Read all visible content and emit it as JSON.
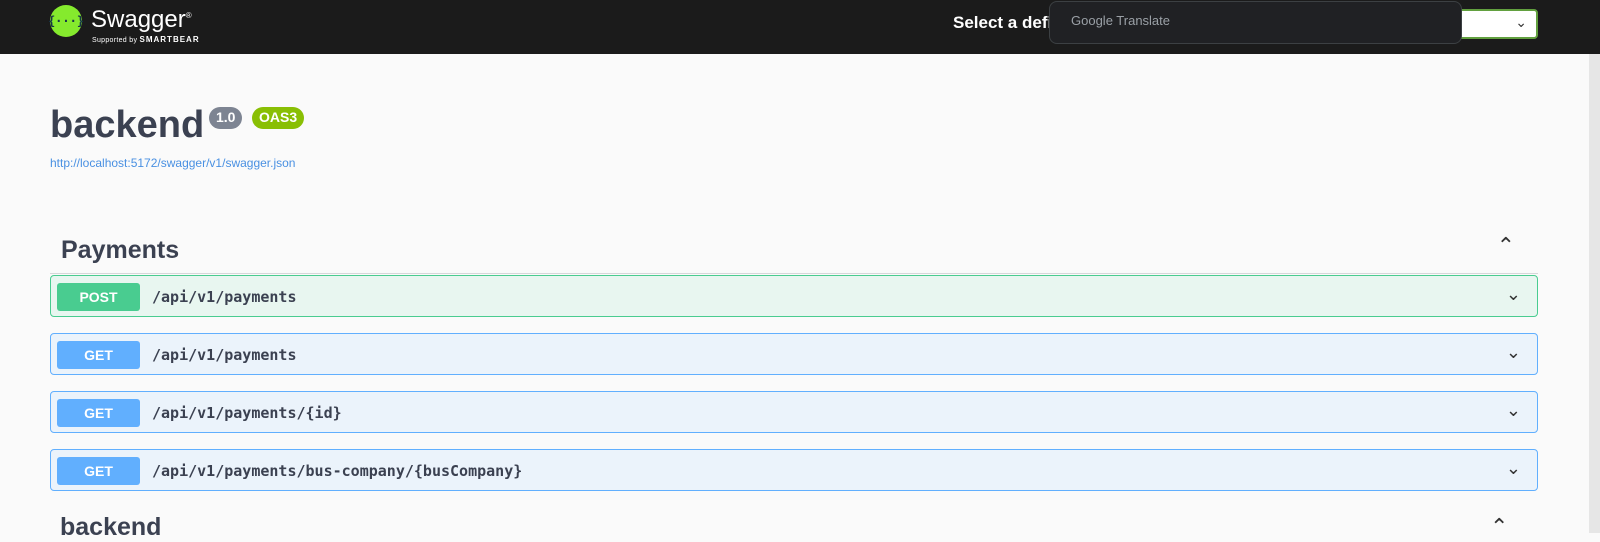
{
  "header": {
    "brand": "Swagger",
    "brand_tm": "®",
    "brand_sub_prefix": "Supported by",
    "brand_sub_company": "SMARTBEAR",
    "logo_glyph": "{···}",
    "select_label": "Select a definition",
    "select_chevron_icon": "chevron-down-icon"
  },
  "translate_popup": {
    "label": "Google Translate"
  },
  "info": {
    "title": "backend",
    "version": "1.0",
    "oas": "OAS3",
    "spec_url": "http://localhost:5172/swagger/v1/swagger.json"
  },
  "sections": [
    {
      "name": "Payments",
      "toggle": "⌃",
      "operations": [
        {
          "method": "POST",
          "path": "/api/v1/payments"
        },
        {
          "method": "GET",
          "path": "/api/v1/payments"
        },
        {
          "method": "GET",
          "path": "/api/v1/payments/{id}"
        },
        {
          "method": "GET",
          "path": "/api/v1/payments/bus-company/{busCompany}"
        }
      ]
    },
    {
      "name": "backend",
      "toggle": "⌃"
    }
  ],
  "colors": {
    "post": "#49cc90",
    "get": "#61affe",
    "topbar": "#1b1b1b",
    "oas_badge": "#89bf04"
  }
}
